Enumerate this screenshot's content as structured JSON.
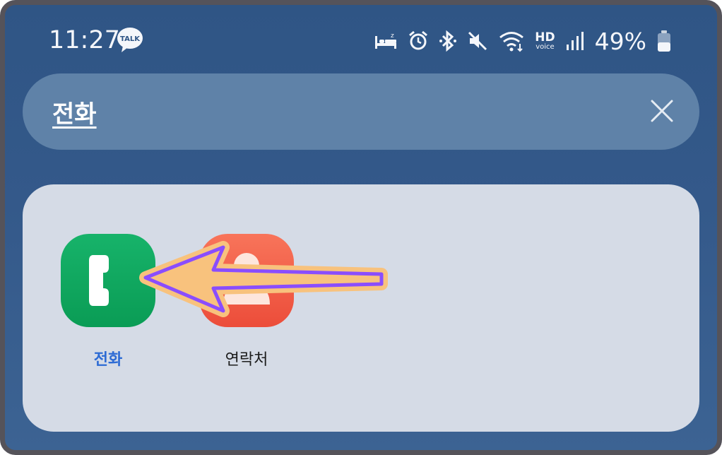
{
  "status_bar": {
    "time": "11:27",
    "talk_badge": "TALK",
    "hd_label": "HD",
    "voice_label": "voice",
    "battery_percent": "49%",
    "battery_level": 0.49,
    "icons": [
      "kakaotalk-icon",
      "sleep-mode-icon",
      "alarm-icon",
      "bluetooth-icon",
      "mute-icon",
      "wifi-icon",
      "hd-voice-icon",
      "signal-icon",
      "battery-icon"
    ]
  },
  "search": {
    "query": "전화",
    "clear_icon": "close-icon"
  },
  "results": {
    "apps": [
      {
        "label": "전화",
        "icon": "phone-app-icon",
        "color": "#12a862"
      },
      {
        "label": "연락처",
        "icon": "contacts-app-icon",
        "color": "#f25e47"
      }
    ]
  },
  "colors": {
    "background": "#34598a",
    "search_bar": "#5f82a8",
    "card": "#d5dbe6",
    "highlight_label": "#2d6bd4",
    "arrow_fill": "#f8c27d",
    "arrow_stroke": "#8a4dff"
  }
}
